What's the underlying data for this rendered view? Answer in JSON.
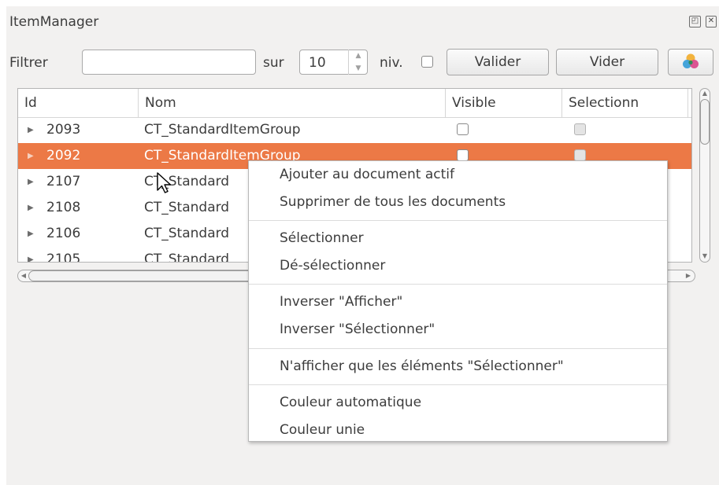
{
  "window": {
    "title": "ItemManager"
  },
  "toolbar": {
    "filter_label": "Filtrer",
    "filter_value": "",
    "sur_label": "sur",
    "level_value": "10",
    "niv_label": "niv.",
    "validate_label": "Valider",
    "clear_label": "Vider",
    "color_icon": "color-palette-icon"
  },
  "table": {
    "columns": [
      "Id",
      "Nom",
      "Visible",
      "Selectionn"
    ],
    "rows": [
      {
        "id": "2093",
        "name": "CT_StandardItemGroup"
      },
      {
        "id": "2092",
        "name": "CT_StandardItemGroup"
      },
      {
        "id": "2107",
        "name": "CT_Standard"
      },
      {
        "id": "2108",
        "name": "CT_Standard"
      },
      {
        "id": "2106",
        "name": "CT_Standard"
      },
      {
        "id": "2105",
        "name": "CT_Standard"
      }
    ]
  },
  "context_menu": {
    "items": [
      "Ajouter au document actif",
      "Supprimer de tous les documents",
      "Sélectionner",
      "Dé-sélectionner",
      "Inverser \"Afficher\"",
      "Inverser \"Sélectionner\"",
      "N'afficher que les éléments \"Sélectionner\"",
      "Couleur automatique",
      "Couleur unie"
    ]
  },
  "colors": {
    "selection": "#ec7946",
    "panel": "#f2f1f0"
  }
}
